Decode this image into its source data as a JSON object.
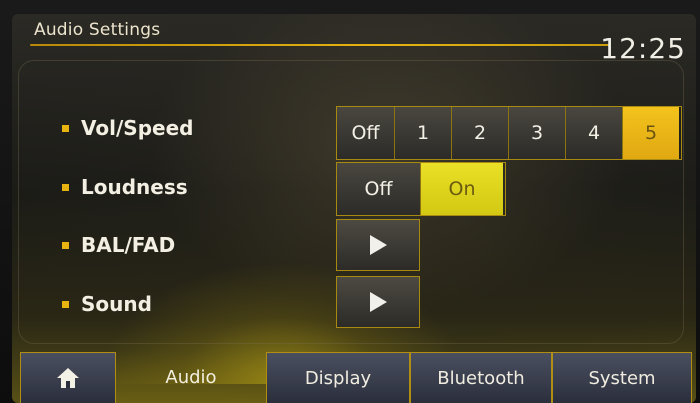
{
  "header": {
    "title": "Audio Settings",
    "clock": "12:25"
  },
  "settings": {
    "vol_speed": {
      "label": "Vol/Speed",
      "options": [
        "Off",
        "1",
        "2",
        "3",
        "4",
        "5"
      ],
      "selected": "5"
    },
    "loudness": {
      "label": "Loudness",
      "options": [
        "Off",
        "On"
      ],
      "selected": "On"
    },
    "bal_fad": {
      "label": "BAL/FAD"
    },
    "sound": {
      "label": "Sound"
    }
  },
  "tabs": {
    "home": "home-icon",
    "audio": "Audio",
    "display": "Display",
    "bluetooth": "Bluetooth",
    "system": "System"
  },
  "colors": {
    "accent": "#e6b310",
    "selected": "#f3c31c",
    "tab_bg": "#3a3f4e"
  }
}
